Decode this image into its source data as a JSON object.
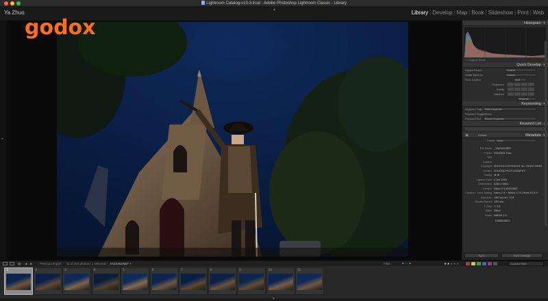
{
  "window": {
    "title": "Lightroom Catalog-v13-3.lrcat - Adobe Photoshop Lightroom Classic - Library"
  },
  "identity": {
    "user": "Ya Zhuo"
  },
  "modules": [
    {
      "label": "Library",
      "active": true
    },
    {
      "label": "Develop",
      "active": false
    },
    {
      "label": "Map",
      "active": false
    },
    {
      "label": "Book",
      "active": false
    },
    {
      "label": "Slideshow",
      "active": false
    },
    {
      "label": "Print",
      "active": false
    },
    {
      "label": "Web",
      "active": false
    }
  ],
  "overlay_logo": "Godox",
  "panels": {
    "histogram": {
      "title": "Histogram",
      "original_photo": "Original Photo"
    },
    "quick_develop": {
      "title": "Quick Develop",
      "saved_preset": {
        "label": "Saved Preset",
        "value": "Custom"
      },
      "white_balance": {
        "label": "White Balance",
        "value": "Custom"
      },
      "tone_control": {
        "label": "Tone Control",
        "value": "Auto"
      },
      "exposure": "Exposure",
      "clarity": "Clarity",
      "vibrance": "Vibrance",
      "reset": "Reset All"
    },
    "keywording": {
      "title": "Keywording",
      "keyword_tags": {
        "label": "Keyword Tags",
        "value": "Enter Keywords"
      },
      "keyword_suggestions": "Keyword Suggestions",
      "keyword_set": {
        "label": "Keyword Set",
        "value": "Recent Keywords"
      }
    },
    "keyword_list": {
      "title": "Keyword List"
    },
    "metadata": {
      "title": "Metadata",
      "default": "Default",
      "preset": {
        "label": "Preset",
        "value": "None"
      },
      "fields": [
        {
          "key": "File Name",
          "value": "_YAZ3451NEF"
        },
        {
          "key": "Folder",
          "value": "20250501 Raw"
        },
        {
          "key": "Title",
          "value": ""
        },
        {
          "key": "Caption",
          "value": ""
        },
        {
          "key": "Copyright",
          "value": "ZHUOYA COPYRIGHT ALL RIGHT RESERVED"
        },
        {
          "key": "Creator",
          "value": "ZHUOYA PHOTOGRAPHY"
        },
        {
          "key": "Rating",
          "value": "★ ★ · · ·"
        },
        {
          "key": "Capture Date",
          "value": "4 Jun 2025"
        },
        {
          "key": "Dimensions",
          "value": "8256 x 5504"
        },
        {
          "key": "Camera",
          "value": "Nikon Z 8 #3002882"
        },
        {
          "key": "Camera + Lens Setting",
          "value": "Nikon Z 8 + Nikkor Z 14-24mm f/2.8 S"
        },
        {
          "key": "Exposure",
          "value": "1/50 sec at f / 2.8"
        },
        {
          "key": "Shutter Speed",
          "value": "1/50 sec"
        },
        {
          "key": "F-Stop",
          "value": "f / 2.8"
        },
        {
          "key": "Make",
          "value": "Nikon"
        },
        {
          "key": "Model",
          "value": "NIKON Z 8"
        }
      ],
      "customize": "Customize..."
    },
    "sync": {
      "sync_meta": "Sync",
      "sync_settings": "Sync Settings"
    }
  },
  "filmstrip_bar": {
    "source": "Previous Import",
    "count": "11 of 304 photos / 1 selected /",
    "selected_file": "_YAZ3451NEF",
    "filter": "Filter :",
    "custom_filter": "Custom Filter"
  },
  "filmstrip": {
    "selected_index": 0,
    "numbers": [
      "1",
      "2",
      "3",
      "4",
      "5",
      "6",
      "7",
      "8",
      "9",
      "10",
      "11"
    ]
  },
  "colors": {
    "brand": "#ff6d1f",
    "panel_bg": "#2c2c2c",
    "active_module": "#ffffff",
    "inactive_module": "#8c8c8c"
  }
}
